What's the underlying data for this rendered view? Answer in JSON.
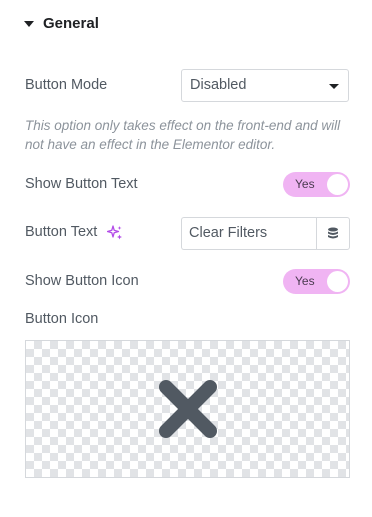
{
  "section": {
    "title": "General"
  },
  "button_mode": {
    "label": "Button Mode",
    "value": "Disabled"
  },
  "note": "This option only takes effect on the front-end and will not have an effect in the Elementor editor.",
  "show_button_text": {
    "label": "Show Button Text",
    "toggle": "Yes"
  },
  "button_text": {
    "label": "Button Text",
    "value": "Clear Filters"
  },
  "show_button_icon": {
    "label": "Show Button Icon",
    "toggle": "Yes"
  },
  "button_icon": {
    "label": "Button Icon",
    "icon": "close-x-icon"
  },
  "colors": {
    "toggle_bg": "#f0b4f3",
    "sparkle": "#b34ce8",
    "icon": "#515962"
  }
}
